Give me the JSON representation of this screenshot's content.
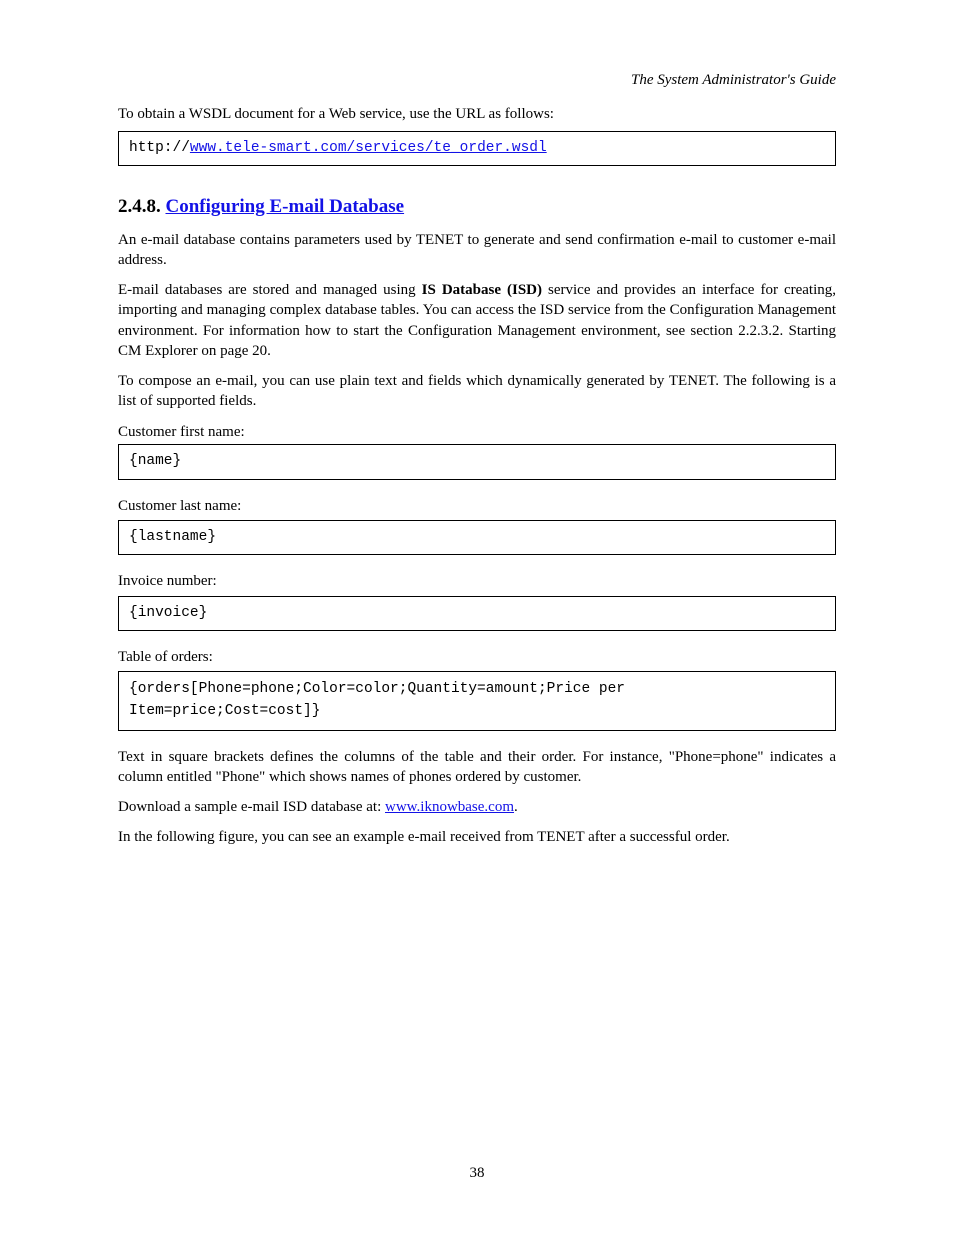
{
  "header": {
    "right": "The System Administrator's Guide"
  },
  "intro_box": "To obtain a WSDL document for a Web service, use the URL as follows:",
  "wsdl_box": {
    "prefix": "http://",
    "url": "www.tele-smart.com/services/te_order.wsdl",
    "link": "www.tele-smart.com"
  },
  "section": {
    "number": "2.4.8.",
    "title": "Configuring E-mail Database"
  },
  "paragraphs": {
    "p1": "An e-mail database contains parameters used by TENET to generate and send confirmation e-mail to customer e-mail address.",
    "p2_part1": "E-mail databases are stored and managed using ",
    "p2_bold": "IS Database (ISD)",
    "p2_part2": " service and provides an interface for creating, importing and managing complex database tables. You can access the ISD service from the Configuration Management environment. For information how to start the Configuration Management environment, see section 2.2.3.2. Starting CM Explorer on page 20.",
    "p3": "To compose an e-mail, you can use plain text and fields which dynamically generated by TENET. The following is a list of supported fields."
  },
  "fields": {
    "f1": {
      "intro": "Customer first name:",
      "value": "{name}"
    },
    "f2": {
      "intro": "Customer last name:",
      "value": "{lastname}"
    },
    "f3": {
      "intro": "Invoice number:",
      "value": "{invoice}"
    },
    "f4": {
      "intro": "Table of orders:",
      "value": "{orders[Phone=phone;Color=color;Quantity=amount;Price per Item=price;Cost=cost]}"
    }
  },
  "orders_explain": "Text in square brackets defines the columns of the table and their order. For instance, \"Phone=phone\" indicates a column entitled \"Phone\" which shows names of phones ordered by customer.",
  "download_text_pre": "Download a sample e-mail ISD database at: ",
  "download_link": "www.iknowbase.com",
  "download_text_post": ".",
  "figure_caption": "In the following figure, you can see an example e-mail received from TENET after a successful order.",
  "page_number": "38"
}
